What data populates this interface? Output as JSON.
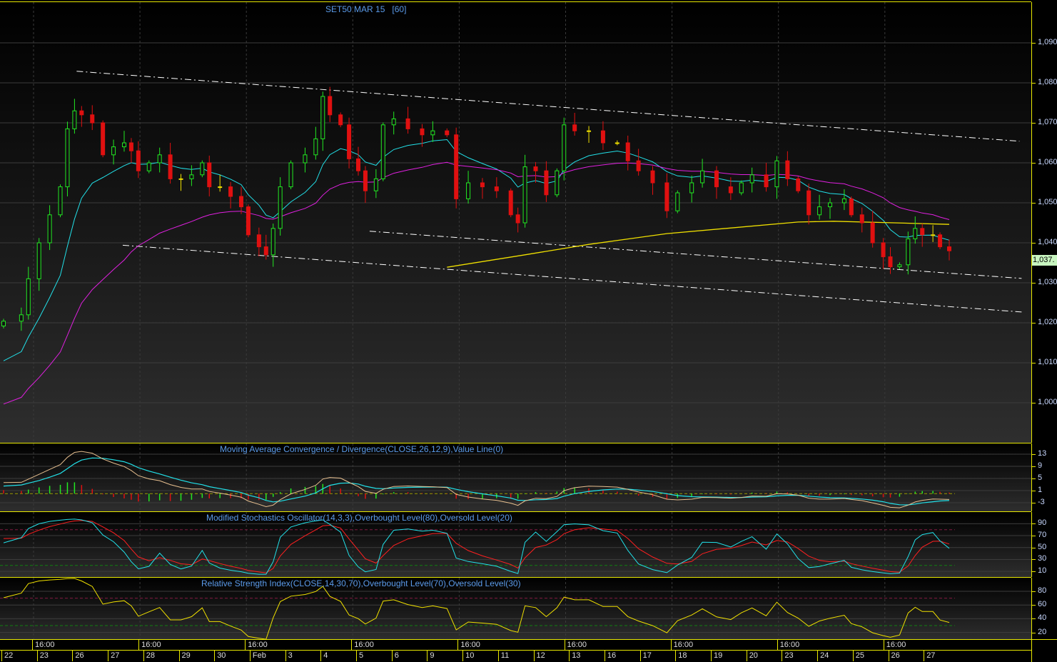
{
  "chart_data": {
    "type": "candlestick",
    "title": "SET50 MAR 15",
    "interval": "[60]",
    "last_price": "1,037.",
    "price_axis": {
      "ticks": [
        "1,090",
        "1,080",
        "1,070",
        "1,060",
        "1,050",
        "1,040",
        "1,030",
        "1,020",
        "1,010",
        "1,000"
      ],
      "ylim": [
        995,
        1101
      ]
    },
    "time_axis": {
      "hour_labels": [
        "16:00",
        "16:00",
        "16:00",
        "16:00",
        "16:00",
        "16:00",
        "16:00",
        "16:00",
        "16:00"
      ],
      "day_labels": [
        "22",
        "23",
        "26",
        "27",
        "28",
        "29",
        "30",
        "Feb",
        "3",
        "4",
        "5",
        "6",
        "9",
        "10",
        "11",
        "12",
        "13",
        "16",
        "17",
        "18",
        "19",
        "20",
        "23",
        "24",
        "25",
        "26",
        "27"
      ]
    },
    "candles_t_close": [
      [
        0,
        1020.4
      ],
      [
        0.5,
        1022
      ],
      [
        0.7,
        1031
      ],
      [
        1.0,
        1040
      ],
      [
        1.3,
        1047
      ],
      [
        1.6,
        1054
      ],
      [
        1.8,
        1068.5
      ],
      [
        2.0,
        1073
      ],
      [
        2.2,
        1072
      ],
      [
        2.5,
        1070
      ],
      [
        2.8,
        1062
      ],
      [
        3.1,
        1064
      ],
      [
        3.4,
        1065
      ],
      [
        3.6,
        1063
      ],
      [
        3.8,
        1058
      ],
      [
        4.1,
        1060
      ],
      [
        4.4,
        1062
      ],
      [
        4.7,
        1056
      ],
      [
        5.0,
        1056
      ],
      [
        5.3,
        1057
      ],
      [
        5.6,
        1060
      ],
      [
        5.8,
        1054
      ],
      [
        6.1,
        1054
      ],
      [
        6.4,
        1051.6
      ],
      [
        6.7,
        1049
      ],
      [
        6.9,
        1042
      ],
      [
        7.2,
        1039
      ],
      [
        7.4,
        1037
      ],
      [
        7.6,
        1043.6
      ],
      [
        7.8,
        1054
      ],
      [
        8.1,
        1060
      ],
      [
        8.5,
        1062
      ],
      [
        8.8,
        1066
      ],
      [
        9.0,
        1076.6
      ],
      [
        9.2,
        1072
      ],
      [
        9.5,
        1069.5
      ],
      [
        9.74,
        1061
      ],
      [
        10.0,
        1058
      ],
      [
        10.2,
        1053
      ],
      [
        10.5,
        1056
      ],
      [
        10.7,
        1069.5
      ],
      [
        11.0,
        1071
      ],
      [
        11.4,
        1068.5
      ],
      [
        11.8,
        1067
      ],
      [
        12.1,
        1068
      ],
      [
        12.5,
        1067
      ],
      [
        12.76,
        1051
      ],
      [
        13.1,
        1055
      ],
      [
        13.5,
        1054
      ],
      [
        13.9,
        1053
      ],
      [
        14.3,
        1047
      ],
      [
        14.5,
        1045
      ],
      [
        14.7,
        1059
      ],
      [
        15.0,
        1058
      ],
      [
        15.3,
        1052
      ],
      [
        15.6,
        1058
      ],
      [
        15.8,
        1069.5
      ],
      [
        16.1,
        1068
      ],
      [
        16.5,
        1068
      ],
      [
        16.9,
        1065
      ],
      [
        17.3,
        1065
      ],
      [
        17.6,
        1060.5
      ],
      [
        17.9,
        1058
      ],
      [
        18.3,
        1055
      ],
      [
        18.7,
        1048
      ],
      [
        19.0,
        1052.5
      ],
      [
        19.4,
        1055
      ],
      [
        19.7,
        1058
      ],
      [
        20.1,
        1054
      ],
      [
        20.5,
        1052.5
      ],
      [
        20.8,
        1055
      ],
      [
        21.1,
        1057
      ],
      [
        21.5,
        1054
      ],
      [
        21.8,
        1060.5
      ],
      [
        22.1,
        1056
      ],
      [
        22.4,
        1053
      ],
      [
        22.7,
        1047
      ],
      [
        23.0,
        1049
      ],
      [
        23.3,
        1050
      ],
      [
        23.7,
        1051
      ],
      [
        23.9,
        1047
      ],
      [
        24.2,
        1045
      ],
      [
        24.5,
        1040
      ],
      [
        24.8,
        1036.5
      ],
      [
        25.0,
        1034
      ],
      [
        25.26,
        1034.5
      ],
      [
        25.5,
        1041
      ],
      [
        25.7,
        1043.6
      ],
      [
        25.9,
        1042
      ],
      [
        26.2,
        1042
      ],
      [
        26.4,
        1039
      ],
      [
        26.66,
        1038
      ]
    ],
    "long_ma_t_value": [
      [
        12.5,
        1033.9
      ],
      [
        14.7,
        1037
      ],
      [
        16.5,
        1039.6
      ],
      [
        18.7,
        1042.3
      ],
      [
        22.4,
        1045.2
      ],
      [
        23.4,
        1045.4
      ],
      [
        25.1,
        1045
      ],
      [
        26.66,
        1044.6
      ]
    ],
    "trendlines_t_price": [
      [
        [
          2.06,
          1082.9
        ],
        [
          28.64,
          1065.4
        ]
      ],
      [
        [
          3.36,
          1039.4
        ],
        [
          28.7,
          1022.7
        ]
      ],
      [
        [
          10.32,
          1042.9
        ],
        [
          28.7,
          1031.1
        ]
      ]
    ],
    "indicators": [
      {
        "name": "macd",
        "title": "Moving Average Convergence / Divergence(CLOSE,26,12,9),Value Line(0)",
        "ticks": [
          "13",
          "9",
          "5",
          "1",
          "-3"
        ],
        "ylim": [
          -5,
          16.5
        ]
      },
      {
        "name": "stoch",
        "title": "Modified Stochastics Oscillator(14,3,3),Overbought Level(80),Oversold Level(20)",
        "ticks": [
          "90",
          "70",
          "50",
          "30",
          "10"
        ],
        "ylim": [
          -2,
          110
        ],
        "overbought": 80,
        "oversold": 20
      },
      {
        "name": "rsi",
        "title": "Relative Strength Index(CLOSE,14,30,70),Overbought Level(70),Oversold Level(30)",
        "ticks": [
          "80",
          "60",
          "40",
          "20"
        ],
        "ylim": [
          11,
          100
        ],
        "overbought": 70,
        "oversold": 30
      }
    ],
    "colors": {
      "up": "#22e822",
      "down": "#e01010",
      "doji": "#f0e000",
      "ema_fast": "#22e0e8",
      "ema_slow": "#e020e0",
      "long_ma": "#f0e000",
      "macd": "#e8c090",
      "signal": "#22e0e8",
      "stoch_k": "#22e0e8",
      "stoch_d": "#ff2020",
      "rsi": "#f0e000",
      "trend": "#ffffff"
    }
  }
}
